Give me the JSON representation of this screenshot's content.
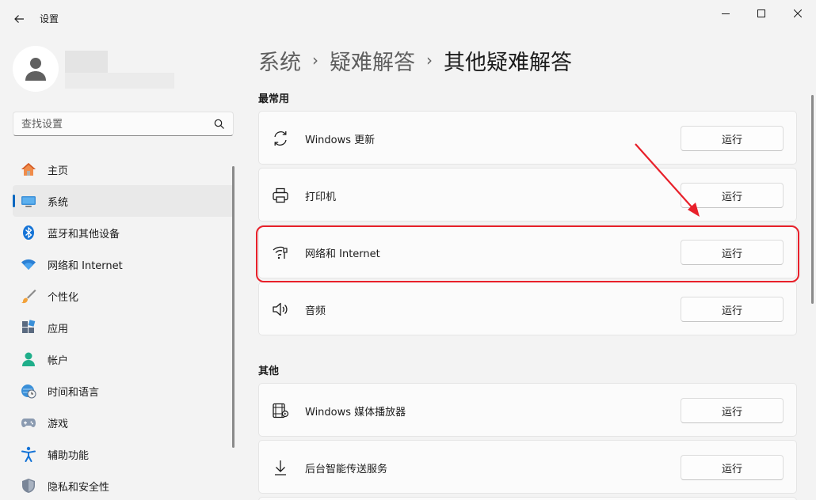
{
  "window": {
    "title": "设置"
  },
  "search": {
    "placeholder": "查找设置"
  },
  "sidebar": {
    "items": [
      {
        "label": "主页",
        "icon": "home-icon"
      },
      {
        "label": "系统",
        "icon": "system-display-icon",
        "active": true
      },
      {
        "label": "蓝牙和其他设备",
        "icon": "bluetooth-icon"
      },
      {
        "label": "网络和 Internet",
        "icon": "wifi-icon"
      },
      {
        "label": "个性化",
        "icon": "paintbrush-icon"
      },
      {
        "label": "应用",
        "icon": "apps-icon"
      },
      {
        "label": "帐户",
        "icon": "account-icon"
      },
      {
        "label": "时间和语言",
        "icon": "globe-clock-icon"
      },
      {
        "label": "游戏",
        "icon": "gamepad-icon"
      },
      {
        "label": "辅助功能",
        "icon": "accessibility-icon"
      },
      {
        "label": "隐私和安全性",
        "icon": "shield-icon"
      }
    ]
  },
  "breadcrumb": {
    "items": [
      "系统",
      "疑难解答"
    ],
    "separator": "›",
    "current": "其他疑难解答"
  },
  "sections": {
    "frequent": {
      "title": "最常用",
      "items": [
        {
          "label": "Windows 更新",
          "icon": "sync-icon",
          "button": "运行"
        },
        {
          "label": "打印机",
          "icon": "printer-icon",
          "button": "运行"
        },
        {
          "label": "网络和 Internet",
          "icon": "network-wifi-icon",
          "button": "运行"
        },
        {
          "label": "音频",
          "icon": "speaker-icon",
          "button": "运行"
        }
      ]
    },
    "other": {
      "title": "其他",
      "items": [
        {
          "label": "Windows 媒体播放器",
          "icon": "media-player-icon",
          "button": "运行"
        },
        {
          "label": "后台智能传送服务",
          "icon": "download-arrow-icon",
          "button": "运行"
        }
      ]
    }
  },
  "colors": {
    "accent": "#0067c0",
    "highlight": "#e8202a",
    "background": "#f3f3f3",
    "card": "#fbfbfb"
  }
}
